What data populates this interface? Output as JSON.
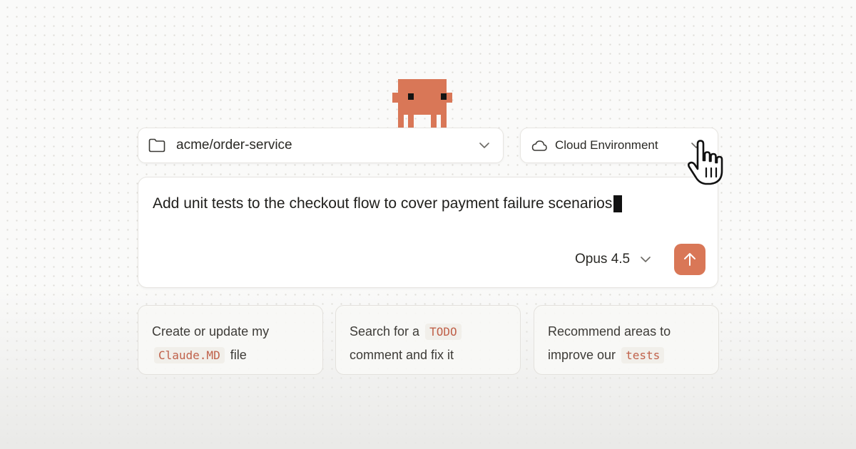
{
  "repo_selector": {
    "label": "acme/order-service",
    "icon": "folder-icon"
  },
  "environment_selector": {
    "label": "Cloud Environment",
    "icon": "cloud-icon"
  },
  "prompt": {
    "text": "Add unit tests to the checkout flow to cover payment failure scenarios"
  },
  "model_selector": {
    "label": "Opus 4.5"
  },
  "send_button": {
    "icon": "arrow-up-icon"
  },
  "suggestions": [
    {
      "before": "Create or update my",
      "code": "Claude.MD",
      "after": "file"
    },
    {
      "before": "Search for a",
      "code": "TODO",
      "after": "comment and fix it"
    },
    {
      "before": "Recommend areas to improve our",
      "code": "tests",
      "after": ""
    }
  ],
  "colors": {
    "accent": "#d97757",
    "code_text": "#c0614a",
    "background": "#fafaf9"
  }
}
